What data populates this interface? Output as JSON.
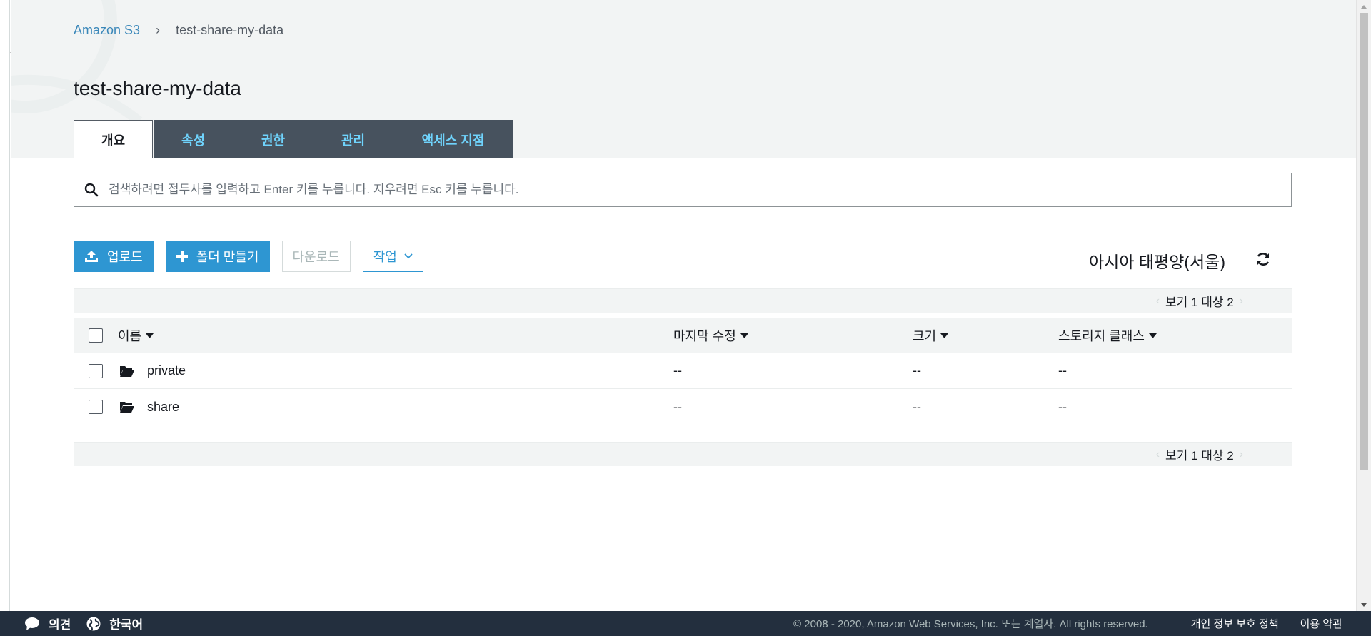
{
  "breadcrumb": {
    "root": "Amazon S3",
    "separator": "›",
    "current": "test-share-my-data"
  },
  "page_title": "test-share-my-data",
  "tabs": [
    {
      "label": "개요",
      "active": true
    },
    {
      "label": "속성",
      "active": false
    },
    {
      "label": "권한",
      "active": false
    },
    {
      "label": "관리",
      "active": false
    },
    {
      "label": "액세스 지점",
      "active": false
    }
  ],
  "search": {
    "placeholder": "검색하려면 접두사를 입력하고 Enter 키를 누릅니다. 지우려면 Esc 키를 누릅니다.",
    "value": ""
  },
  "toolbar": {
    "upload_label": "업로드",
    "create_folder_label": "폴더 만들기",
    "download_label": "다운로드",
    "actions_label": "작업"
  },
  "region": "아시아 태평양(서울)",
  "pager": {
    "text": "보기 1 대상 2"
  },
  "table": {
    "columns": {
      "name": "이름",
      "last_modified": "마지막 수정",
      "size": "크기",
      "storage_class": "스토리지 클래스"
    },
    "rows": [
      {
        "name": "private",
        "last_modified": "--",
        "size": "--",
        "storage_class": "--"
      },
      {
        "name": "share",
        "last_modified": "--",
        "size": "--",
        "storage_class": "--"
      }
    ]
  },
  "footer": {
    "feedback": "의견",
    "language": "한국어",
    "copyright": "© 2008 - 2020, Amazon Web Services, Inc. 또는 계열사. All rights reserved.",
    "privacy": "개인 정보 보호 정책",
    "terms": "이용 약관"
  },
  "colors": {
    "accent": "#2e96d2",
    "tab_bg": "#47525e",
    "tab_text": "#6fd3fc",
    "footer_bg": "#232f3e"
  },
  "icons": [
    "caret-right-icon",
    "search-icon",
    "upload-icon",
    "plus-icon",
    "chevron-down-icon",
    "refresh-icon",
    "sort-caret-icon",
    "folder-open-icon",
    "chat-bubble-icon",
    "globe-icon"
  ]
}
